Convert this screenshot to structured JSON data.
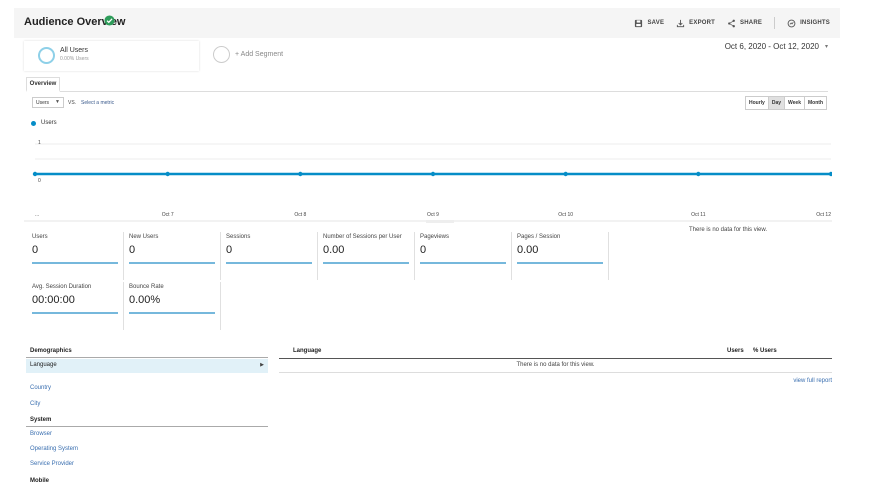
{
  "header": {
    "title": "Audience Overview",
    "actions": [
      {
        "label": "SAVE",
        "icon": "save-icon"
      },
      {
        "label": "EXPORT",
        "icon": "export-icon"
      },
      {
        "label": "SHARE",
        "icon": "share-icon"
      },
      {
        "label": "INSIGHTS",
        "icon": "insights-icon"
      }
    ]
  },
  "segment": {
    "name": "All Users",
    "sub": "0.00% Users",
    "add_label": "+ Add Segment"
  },
  "date_range": "Oct 6, 2020 - Oct 12, 2020",
  "tabs": {
    "overview": "Overview"
  },
  "metric_picker": {
    "selected": "Users",
    "vs": "VS.",
    "select_metric": "Select a metric"
  },
  "granularity": {
    "options": [
      "Hourly",
      "Day",
      "Week",
      "Month"
    ],
    "active": "Day"
  },
  "chart_data": {
    "type": "line",
    "series": [
      {
        "name": "Users",
        "values": [
          0,
          0,
          0,
          0,
          0,
          0,
          0
        ]
      }
    ],
    "x_labels": [
      "...",
      "Oct 7",
      "Oct 8",
      "Oct 9",
      "Oct 10",
      "Oct 11",
      "Oct 12"
    ],
    "y_ticks": [
      "1",
      "0"
    ],
    "ylim": [
      0,
      1
    ],
    "grid": true,
    "color": "#058dc7"
  },
  "metrics": [
    {
      "label": "Users",
      "value": "0"
    },
    {
      "label": "New Users",
      "value": "0"
    },
    {
      "label": "Sessions",
      "value": "0"
    },
    {
      "label": "Number of Sessions per User",
      "value": "0.00"
    },
    {
      "label": "Pageviews",
      "value": "0"
    },
    {
      "label": "Pages / Session",
      "value": "0.00"
    },
    {
      "label": "Avg. Session Duration",
      "value": "00:00:00"
    },
    {
      "label": "Bounce Rate",
      "value": "0.00%"
    }
  ],
  "pie_no_data": "There is no data for this view.",
  "dimensions": {
    "demographics": {
      "heading": "Demographics",
      "items": [
        "Language",
        "Country",
        "City"
      ]
    },
    "system": {
      "heading": "System",
      "items": [
        "Browser",
        "Operating System",
        "Service Provider"
      ]
    },
    "mobile": {
      "heading": "Mobile"
    }
  },
  "table": {
    "column": "Language",
    "col_users": "Users",
    "col_pct": "% Users",
    "no_data": "There is no data for this view.",
    "view_full": "view full report"
  },
  "colors": {
    "accent": "#058dc7",
    "verified": "#2e9c5a",
    "link": "#3a6fb0"
  }
}
